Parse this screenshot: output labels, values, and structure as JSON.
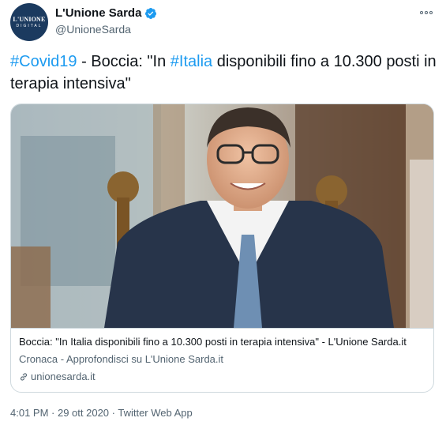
{
  "account": {
    "avatar_text_1": "L'UNIONE",
    "avatar_text_2": "DIGITAL",
    "display_name": "L'Unione Sarda",
    "handle": "@UnioneSarda",
    "verified": true
  },
  "tweet": {
    "hashtag_1": "#Covid19",
    "text_1": " - Boccia: \"In ",
    "hashtag_2": "#Italia",
    "text_2": " disponibili fino a 10.300 posti in terapia intensiva\""
  },
  "card": {
    "title": "Boccia: \"In Italia disponibili fino a 10.300 posti in terapia intensiva\" - L'Unione Sarda.it",
    "description": "Cronaca - Approfondisci su L'Unione Sarda.it",
    "domain": "unionesarda.it"
  },
  "meta": {
    "timestamp": "4:01 PM · 29 ott 2020 · Twitter Web App"
  },
  "colors": {
    "accent": "#1d9bf0",
    "avatar_bg": "#1b3a5f",
    "secondary_text": "#536471"
  },
  "icons": [
    "verified-icon",
    "more-icon",
    "link-icon"
  ]
}
